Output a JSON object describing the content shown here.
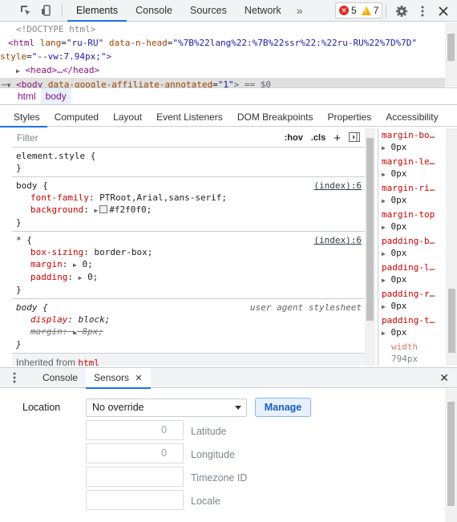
{
  "toolbar": {
    "tabs": [
      "Elements",
      "Console",
      "Sources",
      "Network"
    ],
    "more": "»",
    "errors": "5",
    "warnings": "7",
    "icons": [
      "inspect-icon",
      "device-icon",
      "gear-icon",
      "kebab-icon",
      "close-icon"
    ]
  },
  "dom": {
    "doctype": "<!DOCTYPE html>",
    "html_open": "<html",
    "html_lang_attr": "lang",
    "html_lang_val": "\"ru-RU\"",
    "html_head_attr": "data-n-head",
    "html_head_val": "\"%7B%22lang%22:%7B%22ssr%22:%22ru-RU%22%7D%7D\"",
    "style_attr": "style",
    "style_val": "\"--vw:7.94px;\"",
    "close_gt": ">",
    "head_line": "<head>…</head>",
    "body_line_tag": "<body",
    "body_attr": "data-google-affiliate-annotated",
    "body_val": "\"1\"",
    "body_tail": "> == $0"
  },
  "breadcrumbs": [
    "html",
    "body"
  ],
  "subtabs": [
    "Styles",
    "Computed",
    "Layout",
    "Event Listeners",
    "DOM Breakpoints",
    "Properties",
    "Accessibility"
  ],
  "filter": {
    "placeholder": "Filter",
    "hov": ":hov",
    "cls": ".cls",
    "plus": "+"
  },
  "rules": {
    "element_style": "element.style {",
    "close": "}",
    "body_selector": "body {",
    "body_src": "(index):6",
    "body_font_name": "font-family",
    "body_font_val": "PTRoot,Arial,sans-serif;",
    "body_bg_name": "background",
    "body_bg_val": "#f2f0f0;",
    "star_selector": "* {",
    "star_src": "(index):6",
    "star_bs_name": "box-sizing",
    "star_bs_val": "border-box;",
    "star_margin_name": "margin",
    "star_margin_val": "0;",
    "star_padding_name": "padding",
    "star_padding_val": "0;",
    "ua_selector": "body {",
    "ua_src": "user agent stylesheet",
    "ua_display_name": "display",
    "ua_display_val": "block;",
    "ua_margin_name": "margin",
    "ua_margin_val": "8px;",
    "inherited_label": "Inherited from",
    "inherited_tag": "html"
  },
  "computed": [
    {
      "name": "margin-bo…",
      "value": "0px"
    },
    {
      "name": "margin-le…",
      "value": "0px"
    },
    {
      "name": "margin-ri…",
      "value": "0px"
    },
    {
      "name": "margin-top",
      "value": "0px"
    },
    {
      "name": "padding-b…",
      "value": "0px"
    },
    {
      "name": "padding-l…",
      "value": "0px"
    },
    {
      "name": "padding-r…",
      "value": "0px"
    },
    {
      "name": "padding-t…",
      "value": "0px"
    },
    {
      "name": "width",
      "value": "794px"
    }
  ],
  "drawer": {
    "tabs": [
      "Console",
      "Sensors"
    ],
    "close_tab": "✕",
    "close": "✕"
  },
  "sensors": {
    "location_label": "Location",
    "location_select": "No override",
    "manage_button": "Manage",
    "latitude_value": "0",
    "latitude_label": "Latitude",
    "longitude_value": "0",
    "longitude_label": "Longitude",
    "timezone_label": "Timezone ID",
    "locale_label": "Locale"
  }
}
